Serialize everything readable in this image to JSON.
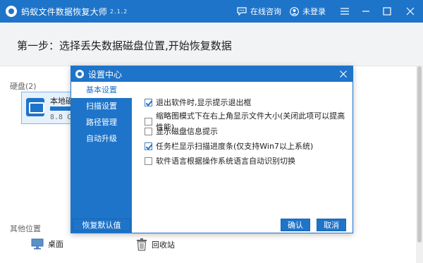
{
  "app": {
    "title": "蚂蚁文件数据恢复大师",
    "version": "2.1.2",
    "consult_label": "在线咨询",
    "login_label": "未登录"
  },
  "step": {
    "title": "第一步：选择丢失数据磁盘位置,开始恢复数据"
  },
  "disks": {
    "section_label": "硬盘(2)",
    "items": [
      {
        "name": "本地磁",
        "size": "8.8 C",
        "used_fraction": 0.45
      }
    ]
  },
  "other_locations": {
    "section_label": "其他位置",
    "items": [
      {
        "label": "桌面",
        "icon": "monitor-icon"
      },
      {
        "label": "回收站",
        "icon": "trash-icon"
      }
    ]
  },
  "dialog": {
    "title": "设置中心",
    "nav": [
      {
        "label": "基本设置",
        "active": true
      },
      {
        "label": "扫描设置",
        "active": false
      },
      {
        "label": "路径管理",
        "active": false
      },
      {
        "label": "自动升级",
        "active": false
      }
    ],
    "options": [
      {
        "label": "退出软件时,显示提示退出框",
        "checked": true
      },
      {
        "label": "缩略图模式下在右上角显示文件大小(关闭此项可以提高性能)",
        "checked": false
      },
      {
        "label": "显示磁盘信息提示",
        "checked": false
      },
      {
        "label": "任务栏显示扫描进度条(仅支持Win7以上系统)",
        "checked": true
      },
      {
        "label": "软件语言根据操作系统语言自动识别切换",
        "checked": false
      }
    ],
    "restore_default_label": "恢复默认值",
    "ok_label": "确认",
    "cancel_label": "取消"
  },
  "colors": {
    "accent": "#1e74c9",
    "header_bg": "#f2f3f5"
  }
}
